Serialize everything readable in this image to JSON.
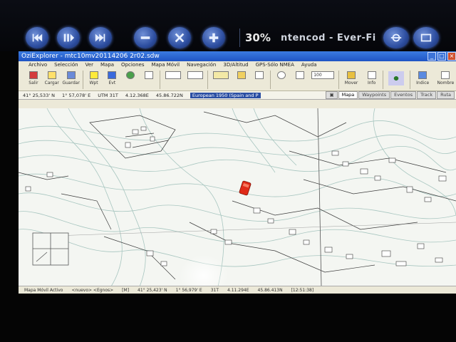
{
  "device": {
    "zoom": "30%",
    "ticker": "ntencod - Ever-Fi",
    "buttons": [
      {
        "name": "previous-icon"
      },
      {
        "name": "play-pause-icon"
      },
      {
        "name": "next-icon"
      },
      {
        "name": "minus-icon"
      },
      {
        "name": "rotate-icon"
      },
      {
        "name": "plus-icon"
      },
      {
        "name": "gps-icon"
      },
      {
        "name": "screen-icon"
      }
    ]
  },
  "window": {
    "title": "OziExplorer - mtc10mv20114206 2r02.sdw",
    "menu": [
      "Archivo",
      "Selección",
      "Ver",
      "Mapa",
      "Opciones",
      "Mapa Móvil",
      "Navegación",
      "3D/Altitud",
      "GPS-Sólo NMEA",
      "Ayuda"
    ],
    "toolbar": [
      "Salir",
      "Cargar",
      "Guardar",
      "Wpt",
      "Evt",
      "",
      "",
      "",
      "",
      "",
      "",
      "",
      "",
      "Mover",
      "Info",
      "",
      "Indice",
      "Nombre"
    ],
    "zoom_value": "100"
  },
  "coords": {
    "lat": "41° 25,533' N",
    "lon": "1° 57,078' E",
    "utm": "UTM  31T",
    "easting": "4.12.368E",
    "northing": "45.86.722N",
    "datum": "European 1950 (Spain and P"
  },
  "tabs": [
    "Mapa",
    "Waypoints",
    "Eventos",
    "Track",
    "Ruta"
  ],
  "status": {
    "mode": "Mapa Móvil Activo",
    "track": "<nuevo> <Egnos>",
    "indicator": "[M]",
    "lat": "41° 25,423' N",
    "lon": "1° 56,979' E",
    "zone": "31T",
    "easting": "4.11.294E",
    "northing": "45.86.413N",
    "time": "[12:51:38]"
  },
  "colors": {
    "title_bar": "#1f54c4",
    "map_lines": "#2a2a2a",
    "contours": "#a8c6c0",
    "vehicle": "#e02a18"
  }
}
